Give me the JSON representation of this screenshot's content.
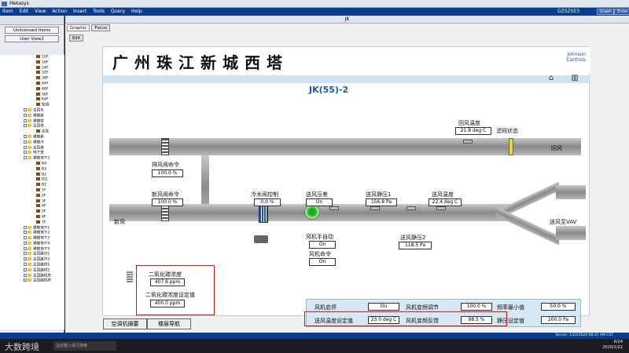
{
  "app": {
    "title": "Metasys",
    "menu": [
      "Item",
      "Edit",
      "View",
      "Action",
      "Insert",
      "Tools",
      "Query",
      "Help"
    ],
    "server": "GZSZSE3",
    "right_buttons": [
      "Graph",
      "Enter"
    ]
  },
  "nav": {
    "header": "Unlicensed Items",
    "view": "User View2",
    "tree": [
      {
        "label": "10F",
        "type": "point"
      },
      {
        "label": "16F",
        "type": "point"
      },
      {
        "label": "24F",
        "type": "point"
      },
      {
        "label": "32F",
        "type": "point"
      },
      {
        "label": "38F",
        "type": "point"
      },
      {
        "label": "44F",
        "type": "point"
      },
      {
        "label": "48F",
        "type": "point"
      },
      {
        "label": "56F",
        "type": "point"
      },
      {
        "label": "64F",
        "type": "point"
      },
      {
        "label": "空调",
        "type": "point"
      },
      {
        "label": "主回水",
        "type": "folder"
      },
      {
        "label": "裙楼新",
        "type": "folder"
      },
      {
        "label": "裙楼空",
        "type": "folder"
      },
      {
        "label": "主回供",
        "type": "folder"
      },
      {
        "label": "主泵",
        "type": "point"
      },
      {
        "label": "裙楼新",
        "type": "folder"
      },
      {
        "label": "裙楼冷",
        "type": "folder"
      },
      {
        "label": "主回排",
        "type": "folder"
      },
      {
        "label": "地下室",
        "type": "folder"
      },
      {
        "label": "裙楼地下2",
        "type": "folder"
      },
      {
        "label": "B4",
        "type": "point"
      },
      {
        "label": "B3",
        "type": "point"
      },
      {
        "label": "B2",
        "type": "point"
      },
      {
        "label": "B1J",
        "type": "point"
      },
      {
        "label": "B1",
        "type": "point"
      },
      {
        "label": "1F",
        "type": "point"
      },
      {
        "label": "2F",
        "type": "point"
      },
      {
        "label": "3F",
        "type": "point"
      },
      {
        "label": "4F",
        "type": "point"
      },
      {
        "label": "5F",
        "type": "point"
      },
      {
        "label": "6F",
        "type": "point"
      },
      {
        "label": "7F",
        "type": "point"
      },
      {
        "label": "裙楼地下1",
        "type": "folder"
      },
      {
        "label": "裙楼地下2",
        "type": "folder"
      },
      {
        "label": "裙楼地下3",
        "type": "folder"
      },
      {
        "label": "裙楼地下4",
        "type": "folder"
      },
      {
        "label": "裙楼地下5",
        "type": "folder"
      },
      {
        "label": "主回路冷1",
        "type": "folder"
      },
      {
        "label": "主回路冷2",
        "type": "folder"
      },
      {
        "label": "主回路供1",
        "type": "folder"
      },
      {
        "label": "主回路供2",
        "type": "folder"
      },
      {
        "label": "主回路机房",
        "type": "folder"
      },
      {
        "label": "主回路机房",
        "type": "folder"
      }
    ]
  },
  "window": {
    "title": "JK",
    "tabs": [
      "Graphic",
      "Focus"
    ],
    "edit_button": "Edit"
  },
  "graphic": {
    "title": "广州珠江新城西塔",
    "logo": [
      "Johnson",
      "Controls"
    ],
    "unit": "JK(55)-2",
    "labels": {
      "return_temp": "回风温度",
      "filter_state": "滤网状态",
      "return_air": "回风",
      "exhaust_cmd": "排风阀命令",
      "fresh_cmd": "新风阀命令",
      "fresh_air": "新风",
      "chw_valve": "冷水阀控制",
      "sa_pressure_diff": "送风压差",
      "sa_static_1": "送风静压1",
      "sa_temp": "送风温度",
      "fan_auto": "风机手自动",
      "fan_cmd": "风机命令",
      "sa_static_2": "送风静压2",
      "sa_vav": "送风至VAV",
      "co2": "二氧化碳浓度",
      "co2_setpoint": "二氧化碳浓度设定值"
    },
    "values": {
      "return_temp": "21.8 deg C",
      "exhaust_cmd": "100.0 %",
      "fresh_cmd": "100.0 %",
      "chw_valve": "0.0 %",
      "sa_pressure_diff": "On",
      "sa_static_1": "156.8 Pa",
      "sa_temp": "22.4 deg C",
      "fan_auto": "On",
      "fan_cmd": "On",
      "sa_static_2": "118.5 Pa",
      "co2": "407.6 ppm",
      "co2_setpoint": "400.0 ppm"
    },
    "bottom_table": [
      [
        {
          "label": "风机启停",
          "value": "On"
        },
        {
          "label": "风机变频调节",
          "value": "100.0 %"
        },
        {
          "label": "频率最小值",
          "value": "50.0 %"
        }
      ],
      [
        {
          "label": "送风温度设定值",
          "value": "23.0 deg C"
        },
        {
          "label": "风机变频反馈",
          "value": "98.5 %"
        },
        {
          "label": "静压设定值",
          "value": "200.0 Pa"
        }
      ]
    ],
    "nav_buttons": [
      "空调机摘要",
      "楼层导航"
    ]
  },
  "status": {
    "server": "Server: 1/22/2020 08:31 AM CST",
    "page": "8/24",
    "date": "2020/1/22"
  },
  "taskbar": {
    "watermark": "大数跨境",
    "search": "在此键入进行搜索"
  },
  "colors": {
    "menubar": "#0c3c8e",
    "band": "#cfe3f2",
    "highlight": "#d11111",
    "unit_title": "#1b5aa8"
  }
}
